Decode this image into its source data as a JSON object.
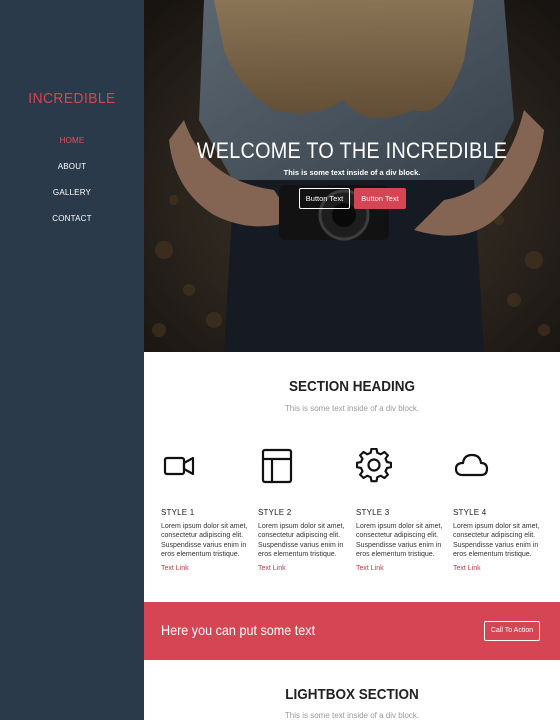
{
  "sidebar": {
    "brand": "INCREDIBLE",
    "nav": [
      {
        "label": "HOME",
        "active": true
      },
      {
        "label": "ABOUT",
        "active": false
      },
      {
        "label": "GALLERY",
        "active": false
      },
      {
        "label": "CONTACT",
        "active": false
      }
    ]
  },
  "hero": {
    "title": "WELCOME TO THE INCREDIBLE",
    "subtitle": "This is some text inside of a div block.",
    "button_outline": "Button Text",
    "button_primary": "Button Text"
  },
  "features_section": {
    "heading": "SECTION HEADING",
    "subheading": "This is some text inside of a div block.",
    "items": [
      {
        "icon": "video-camera-icon",
        "title": "STYLE 1",
        "body": "Lorem ipsum dolor sit amet, consectetur adipiscing elit. Suspendisse varius enim in eros elementum tristique.",
        "link": "Text Link"
      },
      {
        "icon": "layout-icon",
        "title": "STYLE 2",
        "body": "Lorem ipsum dolor sit amet, consectetur adipiscing elit. Suspendisse varius enim in eros elementum tristique.",
        "link": "Text Link"
      },
      {
        "icon": "gear-icon",
        "title": "STYLE 3",
        "body": "Lorem ipsum dolor sit amet, consectetur adipiscing elit. Suspendisse varius enim in eros elementum tristique.",
        "link": "Text Link"
      },
      {
        "icon": "cloud-icon",
        "title": "STYLE 4",
        "body": "Lorem ipsum dolor sit amet, consectetur adipiscing elit. Suspendisse varius enim in eros elementum tristique.",
        "link": "Text Link"
      }
    ]
  },
  "cta": {
    "text": "Here you can put some text",
    "button": "Call To Action"
  },
  "lightbox": {
    "heading": "LIGHTBOX SECTION",
    "subheading": "This is some text inside of a div block."
  },
  "colors": {
    "sidebar_bg": "#2b3a4a",
    "accent": "#d64553",
    "white": "#ffffff"
  }
}
